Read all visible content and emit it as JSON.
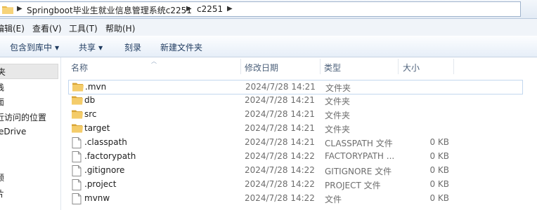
{
  "address": {
    "crumbs": [
      "Springboot毕业生就业信息管理系统c2251",
      "c2251"
    ]
  },
  "menu": {
    "items": [
      "编辑(E)",
      "查看(V)",
      "工具(T)",
      "帮助(H)"
    ]
  },
  "toolbar": {
    "library": "包含到库中",
    "share": "共享",
    "burn": "刻录",
    "new_folder": "新建文件夹"
  },
  "nav": {
    "items": [
      "夹",
      "栈",
      "面",
      "近访问的位置",
      "eDrive",
      "频",
      "片"
    ]
  },
  "columns": {
    "name": "名称",
    "modified": "修改日期",
    "type": "类型",
    "size": "大小"
  },
  "files": [
    {
      "name": ".mvn",
      "date": "2024/7/28 14:21",
      "type": "文件夹",
      "size": "",
      "icon": "folder-icon"
    },
    {
      "name": "db",
      "date": "2024/7/28 14:21",
      "type": "文件夹",
      "size": "",
      "icon": "folder-icon"
    },
    {
      "name": "src",
      "date": "2024/7/28 14:21",
      "type": "文件夹",
      "size": "",
      "icon": "folder-icon"
    },
    {
      "name": "target",
      "date": "2024/7/28 14:21",
      "type": "文件夹",
      "size": "",
      "icon": "folder-icon"
    },
    {
      "name": ".classpath",
      "date": "2024/7/28 14:21",
      "type": "CLASSPATH 文件",
      "size": "0 KB",
      "icon": "file-icon"
    },
    {
      "name": ".factorypath",
      "date": "2024/7/28 14:22",
      "type": "FACTORYPATH ...",
      "size": "0 KB",
      "icon": "file-icon"
    },
    {
      "name": ".gitignore",
      "date": "2024/7/28 14:22",
      "type": "GITIGNORE 文件",
      "size": "0 KB",
      "icon": "file-icon"
    },
    {
      "name": ".project",
      "date": "2024/7/28 14:22",
      "type": "PROJECT 文件",
      "size": "0 KB",
      "icon": "file-icon"
    },
    {
      "name": "mvnw",
      "date": "2024/7/28 14:22",
      "type": "文件",
      "size": "0 KB",
      "icon": "file-icon"
    }
  ]
}
